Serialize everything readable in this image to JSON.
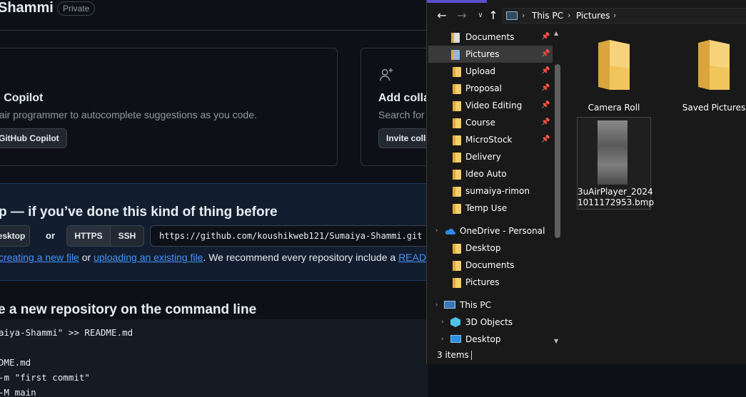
{
  "github": {
    "repo_title": "Shammi",
    "visibility_badge": "Private",
    "copilot_card": {
      "title": "b Copilot",
      "description": "pair programmer to autocomplete suggestions as you code.",
      "button": "GitHub Copilot"
    },
    "collab_card": {
      "title": "Add colla",
      "description": "Search for",
      "button": "Invite colla"
    },
    "quick_setup": {
      "title": "p — if you’ve done this kind of thing before",
      "desktop_button": "esktop",
      "or_text": "or",
      "https_button": "HTTPS",
      "ssh_button": "SSH",
      "clone_url": "https://github.com/koushikweb121/Sumaiya-Shammi.git",
      "link_create": "creating a new file",
      "text_or": " or ",
      "link_upload": "uploading an existing file",
      "text_recommend": ". We recommend every repository include a ",
      "link_readme": "READM"
    },
    "command_line": {
      "title": "e a new repository on the command line",
      "lines": [
        "aiya-Shammi\" >> README.md",
        "DME.md",
        "-m \"first commit\"",
        "-M main"
      ]
    }
  },
  "explorer": {
    "address": {
      "segment1": "This PC",
      "segment2": "Pictures"
    },
    "nav_items": [
      {
        "label": "Documents",
        "pinned": true
      },
      {
        "label": "Pictures",
        "pinned": true,
        "selected": true
      },
      {
        "label": "Upload",
        "pinned": true
      },
      {
        "label": "Proposal",
        "pinned": true
      },
      {
        "label": "Video Editing",
        "pinned": true
      },
      {
        "label": "Course",
        "pinned": true
      },
      {
        "label": "MicroStock",
        "pinned": true
      },
      {
        "label": "Delivery"
      },
      {
        "label": "Ideo Auto"
      },
      {
        "label": "sumaiya-rimon"
      },
      {
        "label": "Temp Use"
      }
    ],
    "onedrive": {
      "label": "OneDrive - Personal",
      "children": [
        "Desktop",
        "Documents",
        "Pictures"
      ]
    },
    "this_pc": {
      "label": "This PC",
      "children": [
        "3D Objects",
        "Desktop"
      ]
    },
    "items": [
      {
        "name": "Camera Roll",
        "type": "folder"
      },
      {
        "name": "Saved Pictures",
        "type": "folder"
      },
      {
        "name": "3uAirPlayer_20241011172953.bmp",
        "name_line1": "3uAirPlayer_2024",
        "name_line2": "1011172953.bmp",
        "type": "bmp"
      }
    ],
    "status": {
      "count": "3 items"
    },
    "colors": {
      "accent": "#5a4fcf",
      "folder": "#f3cd6e",
      "selection": "#3a3a3a"
    }
  }
}
